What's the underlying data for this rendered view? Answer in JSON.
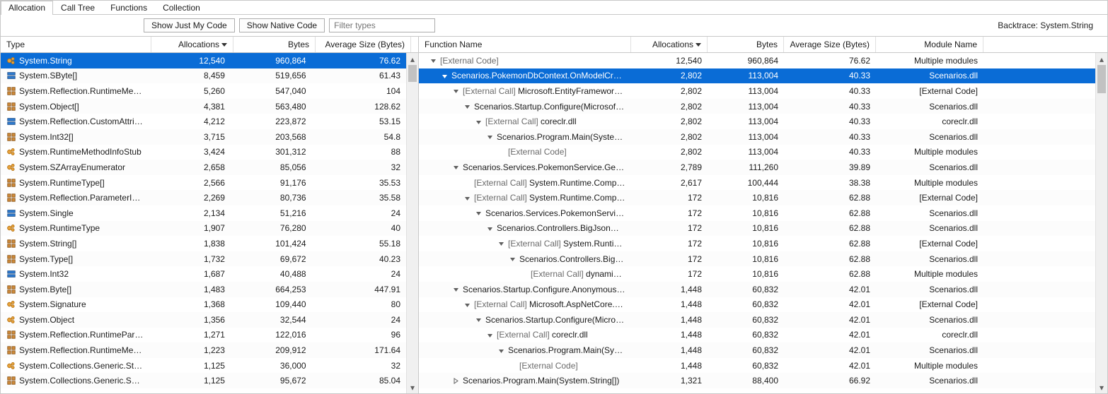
{
  "tabs": [
    "Allocation",
    "Call Tree",
    "Functions",
    "Collection"
  ],
  "active_tab_index": 0,
  "toolbar": {
    "show_my_code": "Show Just My Code",
    "show_native": "Show Native Code",
    "filter_placeholder": "Filter types",
    "backtrace": "Backtrace: System.String"
  },
  "left": {
    "columns": [
      "Type",
      "Allocations",
      "Bytes",
      "Average Size (Bytes)"
    ],
    "sort_col": 1,
    "rows": [
      {
        "icon": "class",
        "name": "System.String",
        "alloc": "12,540",
        "bytes": "960,864",
        "avg": "76.62",
        "sel": true
      },
      {
        "icon": "struct",
        "name": "System.SByte[]",
        "alloc": "8,459",
        "bytes": "519,656",
        "avg": "61.43"
      },
      {
        "icon": "module",
        "name": "System.Reflection.RuntimeMet…",
        "alloc": "5,260",
        "bytes": "547,040",
        "avg": "104"
      },
      {
        "icon": "module",
        "name": "System.Object[]",
        "alloc": "4,381",
        "bytes": "563,480",
        "avg": "128.62"
      },
      {
        "icon": "struct",
        "name": "System.Reflection.CustomAttrib…",
        "alloc": "4,212",
        "bytes": "223,872",
        "avg": "53.15"
      },
      {
        "icon": "module",
        "name": "System.Int32[]",
        "alloc": "3,715",
        "bytes": "203,568",
        "avg": "54.8"
      },
      {
        "icon": "class",
        "name": "System.RuntimeMethodInfoStub",
        "alloc": "3,424",
        "bytes": "301,312",
        "avg": "88"
      },
      {
        "icon": "class",
        "name": "System.SZArrayEnumerator",
        "alloc": "2,658",
        "bytes": "85,056",
        "avg": "32"
      },
      {
        "icon": "module",
        "name": "System.RuntimeType[]",
        "alloc": "2,566",
        "bytes": "91,176",
        "avg": "35.53"
      },
      {
        "icon": "module",
        "name": "System.Reflection.ParameterInf…",
        "alloc": "2,269",
        "bytes": "80,736",
        "avg": "35.58"
      },
      {
        "icon": "struct",
        "name": "System.Single",
        "alloc": "2,134",
        "bytes": "51,216",
        "avg": "24"
      },
      {
        "icon": "class",
        "name": "System.RuntimeType",
        "alloc": "1,907",
        "bytes": "76,280",
        "avg": "40"
      },
      {
        "icon": "module",
        "name": "System.String[]",
        "alloc": "1,838",
        "bytes": "101,424",
        "avg": "55.18"
      },
      {
        "icon": "module",
        "name": "System.Type[]",
        "alloc": "1,732",
        "bytes": "69,672",
        "avg": "40.23"
      },
      {
        "icon": "struct",
        "name": "System.Int32",
        "alloc": "1,687",
        "bytes": "40,488",
        "avg": "24"
      },
      {
        "icon": "module",
        "name": "System.Byte[]",
        "alloc": "1,483",
        "bytes": "664,253",
        "avg": "447.91"
      },
      {
        "icon": "class",
        "name": "System.Signature",
        "alloc": "1,368",
        "bytes": "109,440",
        "avg": "80"
      },
      {
        "icon": "class",
        "name": "System.Object",
        "alloc": "1,356",
        "bytes": "32,544",
        "avg": "24"
      },
      {
        "icon": "module",
        "name": "System.Reflection.RuntimePara…",
        "alloc": "1,271",
        "bytes": "122,016",
        "avg": "96"
      },
      {
        "icon": "module",
        "name": "System.Reflection.RuntimeMet…",
        "alloc": "1,223",
        "bytes": "209,912",
        "avg": "171.64"
      },
      {
        "icon": "class",
        "name": "System.Collections.Generic.Stac…",
        "alloc": "1,125",
        "bytes": "36,000",
        "avg": "32"
      },
      {
        "icon": "module",
        "name": "System.Collections.Generic.Sort…",
        "alloc": "1,125",
        "bytes": "95,672",
        "avg": "85.04"
      }
    ]
  },
  "right": {
    "columns": [
      "Function Name",
      "Allocations",
      "Bytes",
      "Average Size (Bytes)",
      "Module Name"
    ],
    "sort_col": 1,
    "rows": [
      {
        "depth": 0,
        "exp": "open",
        "gray": true,
        "name": "[External Code]",
        "alloc": "12,540",
        "bytes": "960,864",
        "avg": "76.62",
        "mod": "Multiple modules"
      },
      {
        "depth": 1,
        "exp": "open",
        "name": "Scenarios.PokemonDbContext.OnModelCreat…",
        "alloc": "2,802",
        "bytes": "113,004",
        "avg": "40.33",
        "mod": "Scenarios.dll",
        "sel": true
      },
      {
        "depth": 2,
        "exp": "open",
        "grayPrefix": "[External Call] ",
        "name": "Microsoft.EntityFrameworkC…",
        "alloc": "2,802",
        "bytes": "113,004",
        "avg": "40.33",
        "mod": "[External Code]"
      },
      {
        "depth": 3,
        "exp": "open",
        "name": "Scenarios.Startup.Configure(Microsoft.As…",
        "alloc": "2,802",
        "bytes": "113,004",
        "avg": "40.33",
        "mod": "Scenarios.dll"
      },
      {
        "depth": 4,
        "exp": "open",
        "grayPrefix": "[External Call] ",
        "name": "coreclr.dll",
        "alloc": "2,802",
        "bytes": "113,004",
        "avg": "40.33",
        "mod": "coreclr.dll"
      },
      {
        "depth": 5,
        "exp": "open",
        "name": "Scenarios.Program.Main(System.Stri…",
        "alloc": "2,802",
        "bytes": "113,004",
        "avg": "40.33",
        "mod": "Scenarios.dll"
      },
      {
        "depth": 6,
        "exp": "none",
        "gray": true,
        "name": "[External Code]",
        "alloc": "2,802",
        "bytes": "113,004",
        "avg": "40.33",
        "mod": "Multiple modules"
      },
      {
        "depth": 2,
        "exp": "open",
        "name": "Scenarios.Services.PokemonService.GetPoke…",
        "alloc": "2,789",
        "bytes": "111,260",
        "avg": "39.89",
        "mod": "Scenarios.dll"
      },
      {
        "depth": 3,
        "exp": "none",
        "grayPrefix": "[External Call] ",
        "name": "System.Runtime.CompilerSer…",
        "alloc": "2,617",
        "bytes": "100,444",
        "avg": "38.38",
        "mod": "Multiple modules"
      },
      {
        "depth": 3,
        "exp": "open",
        "grayPrefix": "[External Call] ",
        "name": "System.Runtime.CompilerSer…",
        "alloc": "172",
        "bytes": "10,816",
        "avg": "62.88",
        "mod": "[External Code]"
      },
      {
        "depth": 4,
        "exp": "open",
        "name": "Scenarios.Services.PokemonService.GetP…",
        "alloc": "172",
        "bytes": "10,816",
        "avg": "62.88",
        "mod": "Scenarios.dll"
      },
      {
        "depth": 5,
        "exp": "open",
        "name": "Scenarios.Controllers.BigJsonOutputC…",
        "alloc": "172",
        "bytes": "10,816",
        "avg": "62.88",
        "mod": "Scenarios.dll"
      },
      {
        "depth": 6,
        "exp": "open",
        "grayPrefix": "[External Call] ",
        "name": "System.Runtime.Com…",
        "alloc": "172",
        "bytes": "10,816",
        "avg": "62.88",
        "mod": "[External Code]"
      },
      {
        "depth": 7,
        "exp": "open",
        "name": "Scenarios.Controllers.BigJsonOutp…",
        "alloc": "172",
        "bytes": "10,816",
        "avg": "62.88",
        "mod": "Scenarios.dll"
      },
      {
        "depth": 8,
        "exp": "none",
        "grayPrefix": "[External Call] ",
        "name": "dynamicClass.lam…",
        "alloc": "172",
        "bytes": "10,816",
        "avg": "62.88",
        "mod": "Multiple modules"
      },
      {
        "depth": 2,
        "exp": "open",
        "name": "Scenarios.Startup.Configure.AnonymousMeth…",
        "alloc": "1,448",
        "bytes": "60,832",
        "avg": "42.01",
        "mod": "Scenarios.dll"
      },
      {
        "depth": 3,
        "exp": "open",
        "grayPrefix": "[External Call] ",
        "name": "Microsoft.AspNetCore.Builde…",
        "alloc": "1,448",
        "bytes": "60,832",
        "avg": "42.01",
        "mod": "[External Code]"
      },
      {
        "depth": 4,
        "exp": "open",
        "name": "Scenarios.Startup.Configure(Microsoft.As…",
        "alloc": "1,448",
        "bytes": "60,832",
        "avg": "42.01",
        "mod": "Scenarios.dll"
      },
      {
        "depth": 5,
        "exp": "open",
        "grayPrefix": "[External Call] ",
        "name": "coreclr.dll",
        "alloc": "1,448",
        "bytes": "60,832",
        "avg": "42.01",
        "mod": "coreclr.dll"
      },
      {
        "depth": 6,
        "exp": "open",
        "name": "Scenarios.Program.Main(System.Stri…",
        "alloc": "1,448",
        "bytes": "60,832",
        "avg": "42.01",
        "mod": "Scenarios.dll"
      },
      {
        "depth": 7,
        "exp": "none",
        "gray": true,
        "name": "[External Code]",
        "alloc": "1,448",
        "bytes": "60,832",
        "avg": "42.01",
        "mod": "Multiple modules"
      },
      {
        "depth": 2,
        "exp": "closed",
        "name": "Scenarios.Program.Main(System.String[])",
        "alloc": "1,321",
        "bytes": "88,400",
        "avg": "66.92",
        "mod": "Scenarios.dll"
      }
    ]
  }
}
